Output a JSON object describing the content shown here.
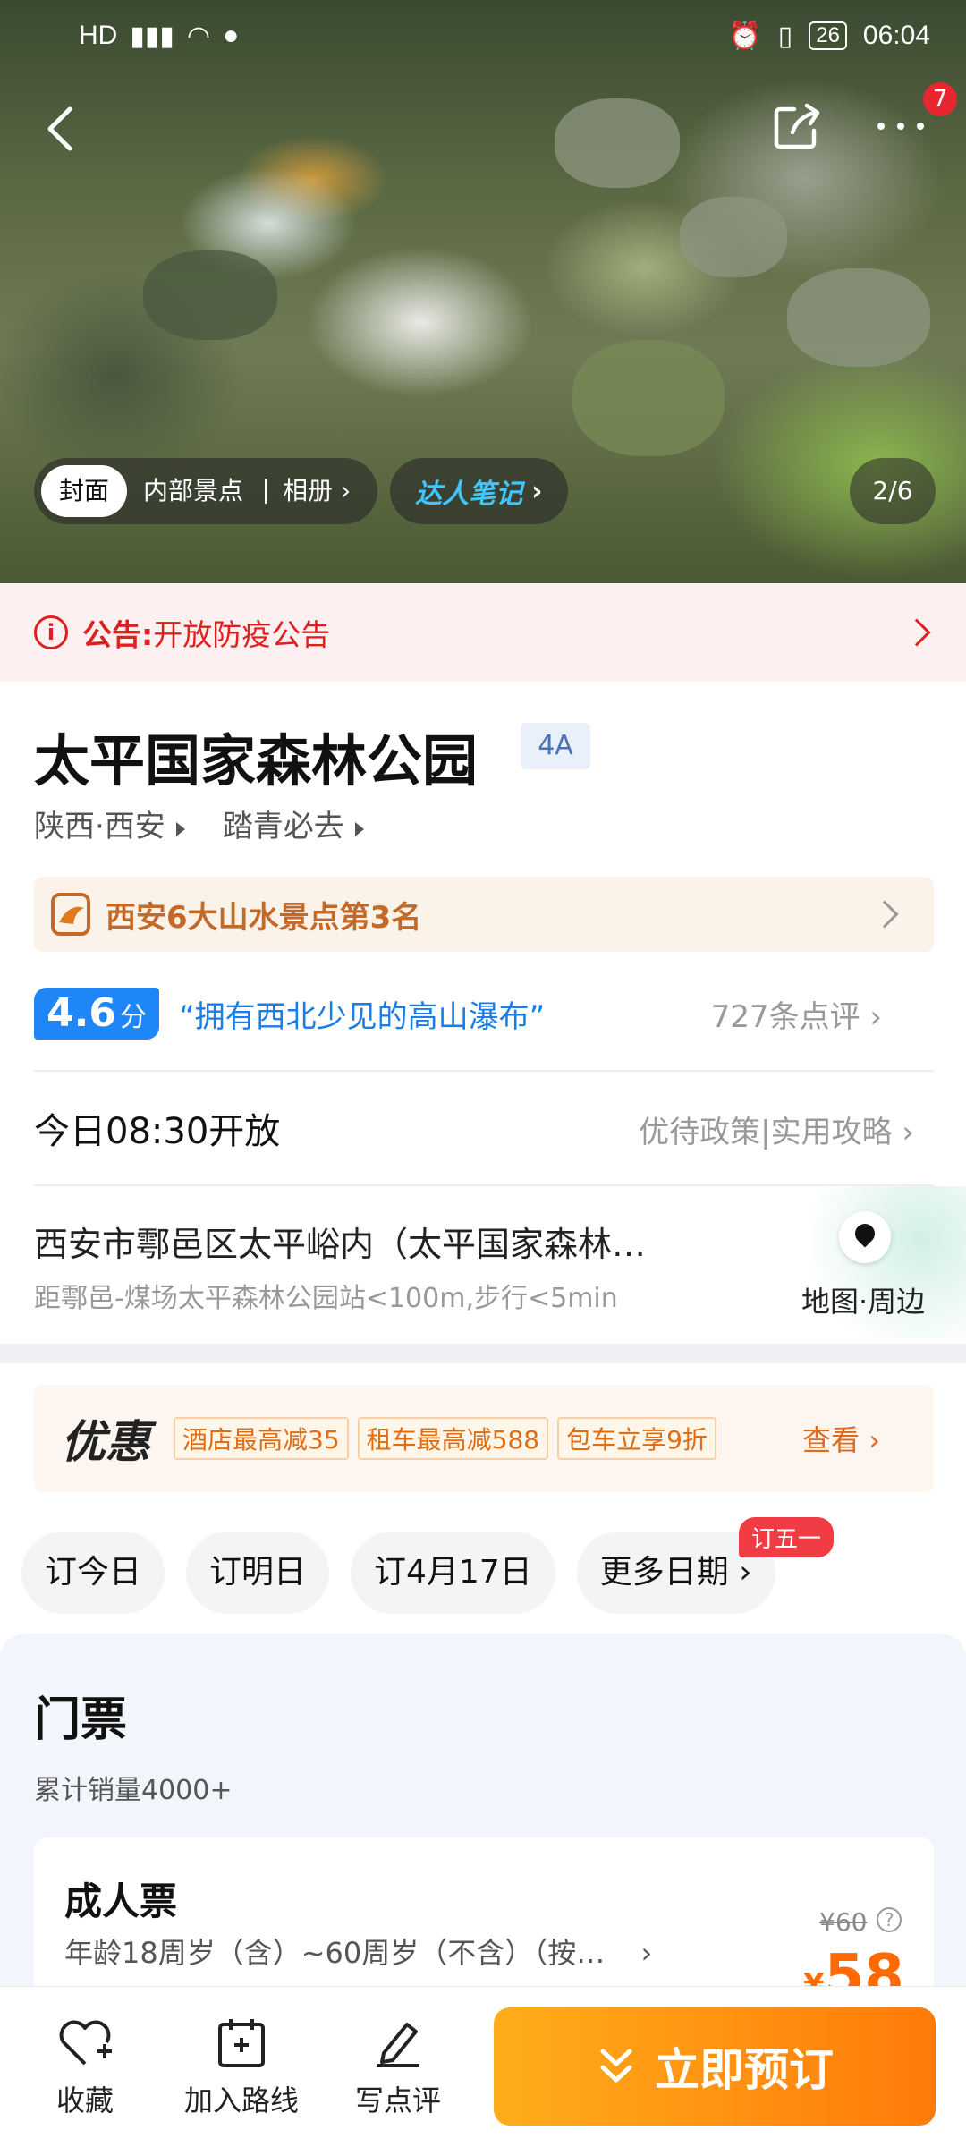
{
  "status": {
    "time": "06:04",
    "battery": "26"
  },
  "hero": {
    "badge": "7",
    "tabs": [
      "封面",
      "内部景点",
      "相册"
    ],
    "daren": "达人笔记",
    "counter": "2/6"
  },
  "notice": {
    "label": "公告:",
    "text": "开放防疫公告"
  },
  "scenic": {
    "name": "太平国家森林公园",
    "grade": "4A",
    "location": "陕西·西安",
    "tagline": "踏青必去"
  },
  "rank": {
    "text": "西安6大山水景点第3名"
  },
  "rating": {
    "score": "4.6",
    "unit": "分",
    "quote": "“拥有西北少见的高山瀑布”",
    "reviews": "727条点评"
  },
  "hours": {
    "open": "今日08:30开放",
    "links": "优待政策|实用攻略"
  },
  "address": {
    "text": "西安市鄠邑区太平峪内（太平国家森林…",
    "distance": "距鄠邑-煤场太平森林公园站<100m,步行<5min",
    "map_label": "地图·周边"
  },
  "promo": {
    "title": "优惠",
    "tags": [
      "酒店最高减35",
      "租车最高减588",
      "包车立享9折"
    ],
    "see": "查看"
  },
  "dates": {
    "options": [
      "订今日",
      "订明日",
      "订4月17日",
      "更多日期"
    ],
    "badge": "订五一"
  },
  "tickets": {
    "title": "门票",
    "sales": "累计销量4000+",
    "items": [
      {
        "name": "成人票",
        "desc": "年龄18周岁（含）~60周岁（不含）（按…",
        "original_price": "¥60",
        "currency": "¥",
        "price": "58"
      }
    ]
  },
  "bottom": {
    "favorite": "收藏",
    "add_route": "加入路线",
    "review": "写点评",
    "book": "立即预订"
  },
  "colors": {
    "accent": "#1e86f6",
    "orange": "#ff7a0a",
    "red": "#e02020"
  }
}
